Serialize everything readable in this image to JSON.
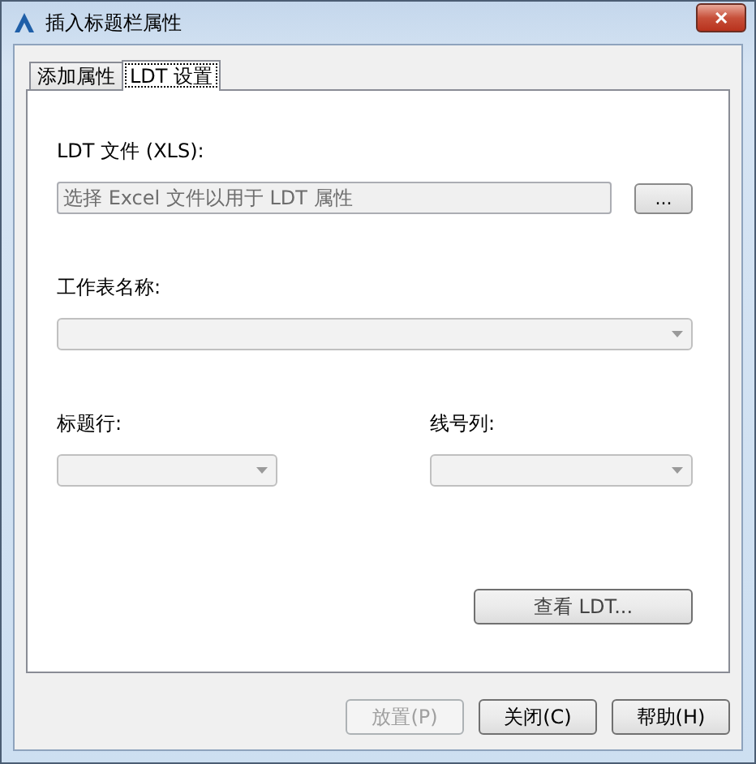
{
  "window": {
    "title": "插入标题栏属性",
    "close": "✕"
  },
  "tabs": [
    {
      "label": "添加属性",
      "selected": false
    },
    {
      "label": "LDT 设置",
      "selected": true
    }
  ],
  "ldt_file": {
    "label": "LDT 文件 (XLS):",
    "placeholder": "选择 Excel 文件以用于 LDT 属性",
    "browse": "..."
  },
  "sheet": {
    "label": "工作表名称:",
    "disabled": true
  },
  "title_row": {
    "label": "标题行:",
    "disabled": true
  },
  "line_column": {
    "label": "线号列:",
    "disabled": true
  },
  "view_button": {
    "label": "查看 LDT...",
    "disabled": false
  },
  "buttons": [
    {
      "label": "放置(P)",
      "disabled": true
    },
    {
      "label": "关闭(C)",
      "disabled": false
    },
    {
      "label": "帮助(H)",
      "disabled": false
    }
  ]
}
